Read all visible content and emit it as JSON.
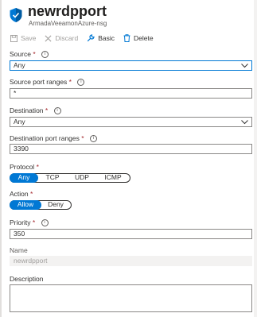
{
  "header": {
    "title": "newrdpport",
    "subtitle": "ArmadaVeeamonAzure-nsg",
    "icon": "shield-icon"
  },
  "toolbar": {
    "save_label": "Save",
    "discard_label": "Discard",
    "basic_label": "Basic",
    "delete_label": "Delete"
  },
  "form": {
    "source": {
      "label": "Source",
      "required": "*",
      "value": "Any"
    },
    "source_port_ranges": {
      "label": "Source port ranges",
      "required": "*",
      "value": "*"
    },
    "destination": {
      "label": "Destination",
      "required": "*",
      "value": "Any"
    },
    "destination_port_ranges": {
      "label": "Destination port ranges",
      "required": "*",
      "value": "3390"
    },
    "protocol": {
      "label": "Protocol",
      "required": "*",
      "options": [
        "Any",
        "TCP",
        "UDP",
        "ICMP"
      ],
      "selected": "Any"
    },
    "action": {
      "label": "Action",
      "required": "*",
      "options": [
        "Allow",
        "Deny"
      ],
      "selected": "Allow"
    },
    "priority": {
      "label": "Priority",
      "required": "*",
      "value": "350"
    },
    "name": {
      "label": "Name",
      "value": "newrdpport"
    },
    "description": {
      "label": "Description",
      "value": ""
    }
  },
  "colors": {
    "accent": "#0078d4",
    "required": "#a4262c",
    "disabled": "#a19f9d"
  }
}
